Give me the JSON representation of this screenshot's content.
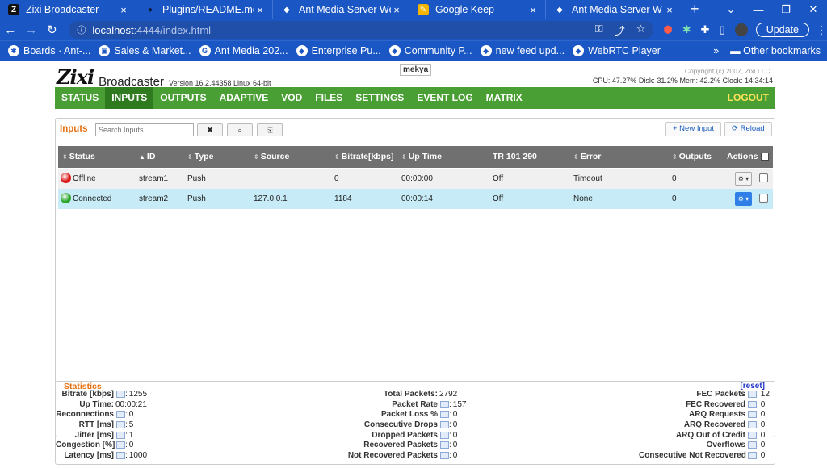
{
  "browser": {
    "tabs": [
      {
        "title": "Zixi Broadcaster",
        "fav": "Z",
        "fav_bg": "#111",
        "fav_fg": "#fff",
        "active": true
      },
      {
        "title": "Plugins/README.md",
        "fav": "●",
        "fav_bg": "#1a56c4",
        "fav_fg": "#0b1d3f",
        "active": false
      },
      {
        "title": "Ant Media Server Web",
        "fav": "◆",
        "fav_bg": "#1a56c4",
        "fav_fg": "#fff",
        "active": false
      },
      {
        "title": "Google Keep",
        "fav": "✎",
        "fav_bg": "#f5b400",
        "fav_fg": "#fff",
        "active": false
      },
      {
        "title": "Ant Media Server W",
        "fav": "◆",
        "fav_bg": "#1a56c4",
        "fav_fg": "#fff",
        "active": false
      }
    ],
    "url_host": "localhost",
    "url_rest": ":4444/index.html",
    "update_label": "Update",
    "bookmarks": [
      {
        "label": "Boards · Ant-...",
        "icon": "✱"
      },
      {
        "label": "Sales & Market...",
        "icon": "▣"
      },
      {
        "label": "Ant Media 202...",
        "icon": "G"
      },
      {
        "label": "Enterprise Pu...",
        "icon": "◆"
      },
      {
        "label": "Community P...",
        "icon": "◆"
      },
      {
        "label": "new feed upd...",
        "icon": "◆"
      },
      {
        "label": "WebRTC Player",
        "icon": "◆"
      }
    ],
    "other_bookmarks": "Other bookmarks"
  },
  "header": {
    "logo": "Zixi",
    "product": "Broadcaster",
    "version": "Version 16.2.44358 Linux 64-bit",
    "host": "mekya",
    "copyright": "Copyright (c) 2007, Zixi LLC.",
    "sysinfo": "CPU: 47.27%  Disk: 31.2%  Mem: 42.2%  Clock: 14:34:14"
  },
  "menu": [
    "STATUS",
    "INPUTS",
    "OUTPUTS",
    "ADAPTIVE",
    "VOD",
    "FILES",
    "SETTINGS",
    "EVENT LOG",
    "MATRIX"
  ],
  "menu_active": "INPUTS",
  "logout": "LOGOUT",
  "inputs": {
    "title": "Inputs",
    "search_placeholder": "Search Inputs",
    "clear": "✖",
    "search_btn": "⌕",
    "copy_btn": "⎘",
    "new_input": "+ New Input",
    "reload": "⟳ Reload",
    "columns": [
      "Status",
      "ID",
      "Type",
      "Source",
      "Bitrate[kbps]",
      "Up Time",
      "TR 101 290",
      "Error",
      "Outputs",
      "Actions"
    ],
    "rows": [
      {
        "status": "Offline",
        "status_color": "#d91414",
        "id": "stream1",
        "type": "Push",
        "source": "",
        "bitrate": "0",
        "uptime": "00:00:00",
        "tr": "Off",
        "error": "Timeout",
        "outputs": "0"
      },
      {
        "status": "Connected",
        "status_color": "#2aa52a",
        "id": "stream2",
        "type": "Push",
        "source": "127.0.0.1",
        "bitrate": "1184",
        "uptime": "00:00:14",
        "tr": "Off",
        "error": "None",
        "outputs": "0"
      }
    ]
  },
  "statistics": {
    "title": "Statistics",
    "reset": "[reset]",
    "col1": [
      {
        "label": "Bitrate [kbps]",
        "value": "1255"
      },
      {
        "label": "Up Time:",
        "value": "00:00:21",
        "nobar": true
      },
      {
        "label": "Reconnections",
        "value": "0"
      },
      {
        "label": "RTT [ms]",
        "value": "5"
      },
      {
        "label": "Jitter [ms]",
        "value": "1"
      },
      {
        "label": "Congestion [%]",
        "value": "0"
      },
      {
        "label": "Latency [ms]",
        "value": "1000"
      }
    ],
    "col2": [
      {
        "label": "Total Packets:",
        "value": "2792",
        "nobar": true
      },
      {
        "label": "Packet Rate",
        "value": "157"
      },
      {
        "label": "Packet Loss %",
        "value": "0"
      },
      {
        "label": "Consecutive Drops",
        "value": "0"
      },
      {
        "label": "Dropped Packets",
        "value": "0"
      },
      {
        "label": "Recovered Packets",
        "value": "0"
      },
      {
        "label": "Not Recovered Packets",
        "value": "0"
      }
    ],
    "col3": [
      {
        "label": "FEC Packets",
        "value": "12"
      },
      {
        "label": "FEC Recovered",
        "value": "0"
      },
      {
        "label": "ARQ Requests",
        "value": "0"
      },
      {
        "label": "ARQ Recovered",
        "value": "0"
      },
      {
        "label": "ARQ Out of Credit",
        "value": "0"
      },
      {
        "label": "Overflows",
        "value": "0"
      },
      {
        "label": "Consecutive Not Recovered",
        "value": "0"
      }
    ]
  }
}
